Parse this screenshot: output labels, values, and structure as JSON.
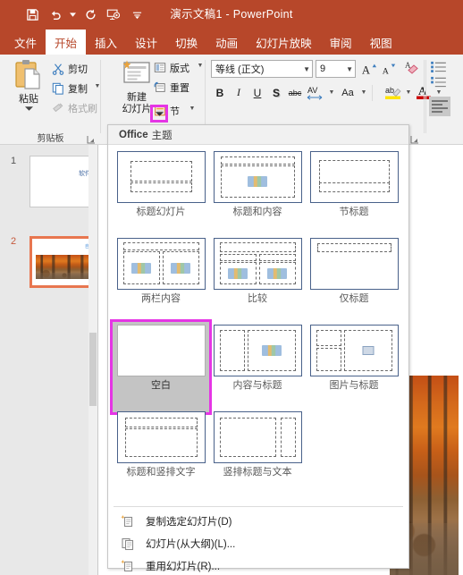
{
  "titlebar": {
    "document_title": "演示文稿1",
    "separator": "-",
    "app_name": "PowerPoint",
    "quick_access": [
      {
        "name": "save-icon",
        "label": "保存"
      },
      {
        "name": "undo-icon",
        "label": "撤消"
      },
      {
        "name": "redo-icon",
        "label": "恢复"
      },
      {
        "name": "start-slideshow-icon",
        "label": "从头开始"
      },
      {
        "name": "customize-qat-icon",
        "label": "自定义快速访问工具栏"
      }
    ]
  },
  "tabs": [
    {
      "label": "文件",
      "active": false
    },
    {
      "label": "开始",
      "active": true
    },
    {
      "label": "插入",
      "active": false
    },
    {
      "label": "设计",
      "active": false
    },
    {
      "label": "切换",
      "active": false
    },
    {
      "label": "动画",
      "active": false
    },
    {
      "label": "幻灯片放映",
      "active": false
    },
    {
      "label": "审阅",
      "active": false
    },
    {
      "label": "视图",
      "active": false
    }
  ],
  "ribbon": {
    "clipboard": {
      "group_label": "剪贴板",
      "paste_label": "粘贴",
      "cut_label": "剪切",
      "copy_label": "复制",
      "format_painter_label": "格式刷"
    },
    "slides": {
      "new_slide_line1": "新建",
      "new_slide_line2": "幻灯片",
      "layout_label": "版式",
      "reset_label": "重置",
      "section_label": "节"
    },
    "font": {
      "font_name": "等线 (正文)",
      "font_size": "9",
      "grow_font": "A",
      "shrink_font": "A",
      "clear_formatting": "清除所有格式",
      "bold": "B",
      "italic": "I",
      "underline": "U",
      "shadow": "S",
      "strikethrough": "abc",
      "character_spacing": "AV",
      "change_case": "Aa",
      "text_highlight": "ab",
      "font_color": "A"
    }
  },
  "slide_panel": {
    "slides": [
      {
        "number": "1",
        "selected": false,
        "text": "软件",
        "has_photo": false
      },
      {
        "number": "2",
        "selected": true,
        "text": "自",
        "has_photo": true
      }
    ]
  },
  "menu": {
    "header_bold": "Office",
    "header_light": "主题",
    "layouts": [
      {
        "caption": "标题幻灯片",
        "selected": false,
        "kind": "title"
      },
      {
        "caption": "标题和内容",
        "selected": false,
        "kind": "title-content"
      },
      {
        "caption": "节标题",
        "selected": false,
        "kind": "section"
      },
      {
        "caption": "两栏内容",
        "selected": false,
        "kind": "two-content"
      },
      {
        "caption": "比较",
        "selected": false,
        "kind": "comparison"
      },
      {
        "caption": "仅标题",
        "selected": false,
        "kind": "title-only"
      },
      {
        "caption": "空白",
        "selected": true,
        "kind": "blank"
      },
      {
        "caption": "内容与标题",
        "selected": false,
        "kind": "content-caption"
      },
      {
        "caption": "图片与标题",
        "selected": false,
        "kind": "picture-caption"
      },
      {
        "caption": "标题和竖排文字",
        "selected": false,
        "kind": "title-vertical-text"
      },
      {
        "caption": "竖排标题与文本",
        "selected": false,
        "kind": "vertical-title-text"
      }
    ],
    "commands": [
      {
        "label": "复制选定幻灯片(D)",
        "accel": "D",
        "icon": "duplicate-slide-icon"
      },
      {
        "label": "幻灯片(从大纲)(L)...",
        "accel": "L",
        "icon": "slides-from-outline-icon"
      },
      {
        "label": "重用幻灯片(R)...",
        "accel": "R",
        "icon": "reuse-slides-icon"
      }
    ]
  },
  "colors": {
    "title_bar": "#b7472a",
    "ribbon_bg": "#f1f1f1",
    "highlight_magenta": "#e535e5",
    "selected_slide_border": "#e8764f",
    "layout_thumb_border": "#49618a"
  }
}
